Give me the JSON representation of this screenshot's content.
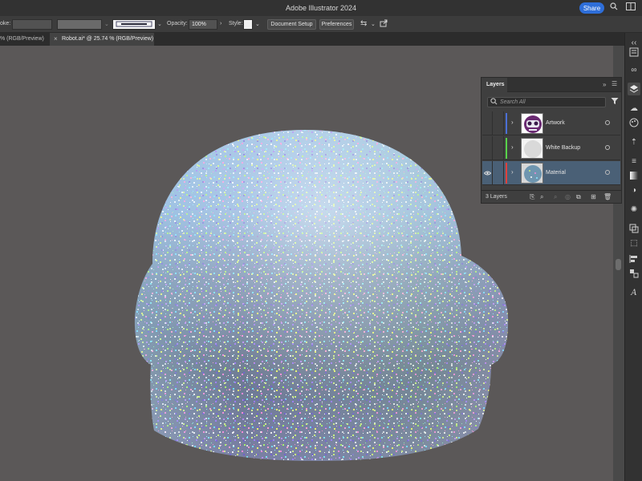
{
  "app": {
    "title": "Adobe Illustrator 2024",
    "share_label": "Share"
  },
  "control_bar": {
    "stroke_label": "oke:",
    "stroke_value": "",
    "opacity_label": "Opacity:",
    "opacity_value": "100%",
    "style_label": "Style:",
    "document_setup_label": "Document Setup",
    "preferences_label": "Preferences"
  },
  "tabs": [
    {
      "label": "% (RGB/Preview)",
      "active": false
    },
    {
      "label": "Robot.ai* @ 25.74 % (RGB/Preview)",
      "active": true
    }
  ],
  "layers_panel": {
    "title": "Layers",
    "search_placeholder": "Search All",
    "layers": [
      {
        "name": "Artwork",
        "color": "#4b6fd6",
        "visible": false,
        "selected": false,
        "thumb": "robot-artwork"
      },
      {
        "name": "White Backup",
        "color": "#58d24a",
        "visible": false,
        "selected": false,
        "thumb": "white-shape"
      },
      {
        "name": "Material",
        "color": "#e0413c",
        "visible": true,
        "selected": true,
        "thumb": "holographic-material"
      }
    ],
    "count_label": "3 Layers"
  },
  "canvas": {
    "background": "#5b5858",
    "artwork": "holographic-glitter-robot-head"
  }
}
